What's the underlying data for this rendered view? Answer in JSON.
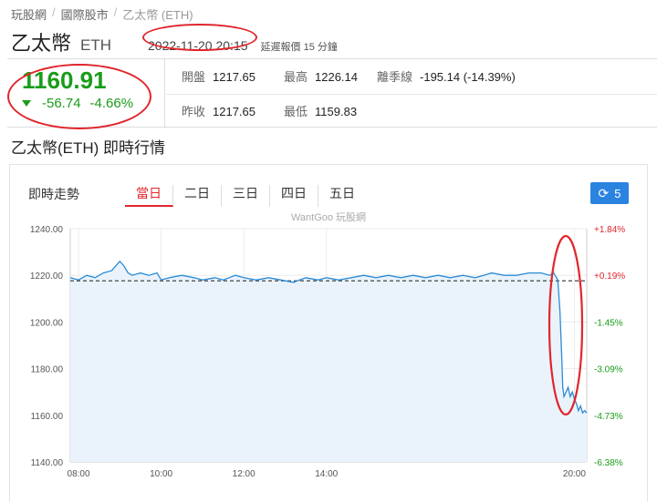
{
  "breadcrumb": [
    "玩股網",
    "國際股市",
    "乙太幣 (ETH)"
  ],
  "header": {
    "name": "乙太幣",
    "symbol": "ETH",
    "datetime": "2022-11-20 20:15",
    "delay_note": "延遲報價 15 分鐘"
  },
  "quote": {
    "price": "1160.91",
    "change": "-56.74",
    "change_pct": "-4.66%",
    "open_label": "開盤",
    "open": "1217.65",
    "high_label": "最高",
    "high": "1226.14",
    "deviation_label": "離季線",
    "deviation": "-195.14 (-14.39%)",
    "prev_close_label": "昨收",
    "prev_close": "1217.65",
    "low_label": "最低",
    "low": "1159.83"
  },
  "section_title": "乙太幣(ETH) 即時行情",
  "chart_panel": {
    "label": "即時走勢",
    "tabs": [
      "當日",
      "二日",
      "三日",
      "四日",
      "五日"
    ],
    "active_tab": 0,
    "refresh_count": "5",
    "watermark": "WantGoo 玩股網"
  },
  "colors": {
    "up": "#e0262c",
    "down": "#1a9c1a",
    "line": "#2b8bd6",
    "accent": "#2b83e0"
  },
  "chart_data": {
    "type": "line",
    "title": "",
    "xlabel": "",
    "ylabel": "",
    "x_ticks": [
      "08:00",
      "10:00",
      "12:00",
      "14:00",
      "20:00"
    ],
    "x_tick_hours": [
      8,
      10,
      12,
      14,
      20
    ],
    "x_range_hours": [
      7.8,
      20.3
    ],
    "ylim": [
      1140,
      1240
    ],
    "y_ticks": [
      "1240.00",
      "1220.00",
      "1200.00",
      "1180.00",
      "1160.00",
      "1140.00"
    ],
    "y_tick_values": [
      1240,
      1220,
      1200,
      1180,
      1160,
      1140
    ],
    "y_right_ticks": [
      "+1.84%",
      "+0.19%",
      "-1.45%",
      "-3.09%",
      "-4.73%",
      "-6.38%"
    ],
    "reference_line": 1217.65,
    "series": [
      {
        "x_hours": [
          7.8,
          8.0,
          8.2,
          8.4,
          8.6,
          8.8,
          9.0,
          9.1,
          9.2,
          9.3,
          9.5,
          9.7,
          9.9,
          10.0,
          10.2,
          10.5,
          10.8,
          11.0,
          11.3,
          11.5,
          11.8,
          12.0,
          12.3,
          12.6,
          12.9,
          13.2,
          13.5,
          13.8,
          14.0,
          14.3,
          14.6,
          14.9,
          15.2,
          15.5,
          15.8,
          16.1,
          16.4,
          16.7,
          17.0,
          17.3,
          17.6,
          17.8,
          18.0,
          18.3,
          18.6,
          18.9,
          19.2,
          19.4,
          19.5,
          19.6,
          19.65,
          19.7,
          19.72,
          19.75,
          19.8,
          19.85,
          19.9,
          19.95,
          20.0,
          20.05,
          20.1,
          20.15,
          20.2,
          20.25,
          20.3
        ],
        "values": [
          1219,
          1218,
          1220,
          1219,
          1221,
          1222,
          1226,
          1224,
          1221,
          1220,
          1221,
          1220,
          1221,
          1218,
          1219,
          1220,
          1219,
          1218,
          1219,
          1218,
          1220,
          1219,
          1218,
          1219,
          1218,
          1217,
          1219,
          1218,
          1219,
          1218,
          1219,
          1220,
          1219,
          1220,
          1219,
          1220,
          1219,
          1220,
          1219,
          1220,
          1219,
          1220,
          1221,
          1220,
          1220,
          1221,
          1221,
          1220,
          1221,
          1218,
          1205,
          1183,
          1172,
          1168,
          1170,
          1172,
          1168,
          1170,
          1167,
          1165,
          1162,
          1164,
          1161,
          1162,
          1161
        ]
      }
    ]
  }
}
